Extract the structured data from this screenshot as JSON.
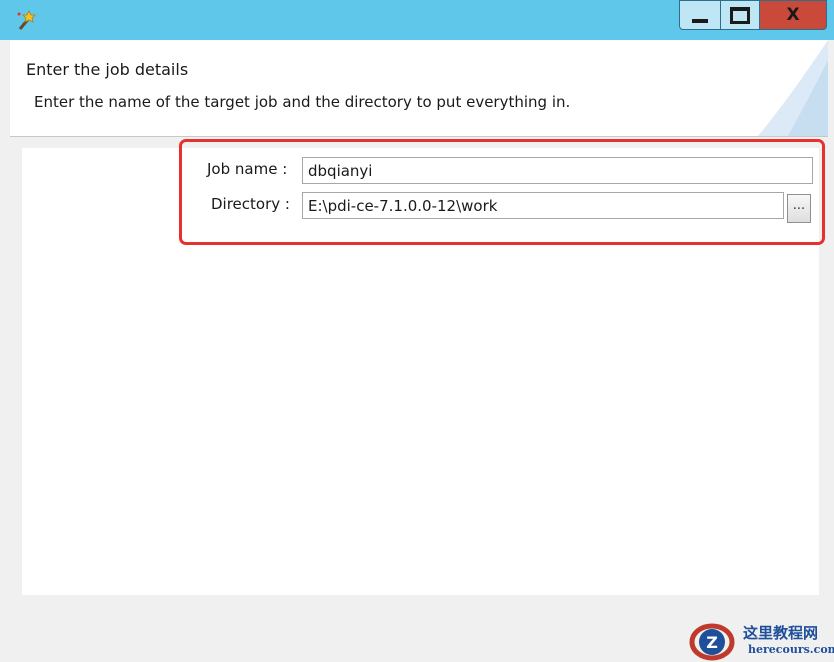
{
  "window": {
    "app_icon": "wizard-wand-icon",
    "controls": {
      "minimize": "minimize-icon",
      "maximize": "maximize-icon",
      "close_label": "X"
    }
  },
  "header": {
    "title": "Enter the job details",
    "description": "Enter the name of the target job and the directory to put everything in."
  },
  "form": {
    "job_name_label": "Job name :",
    "job_name_value": "dbqianyi",
    "directory_label": "Directory :",
    "directory_value": "E:\\pdi-ce-7.1.0.0-12\\work",
    "browse_label": "..."
  },
  "colors": {
    "titlebar": "#5ec7ea",
    "highlight_border": "#e8312c",
    "close_button": "#c94a3a"
  },
  "watermark": {
    "line1": "这里教程网",
    "line2": "herecours.com"
  }
}
